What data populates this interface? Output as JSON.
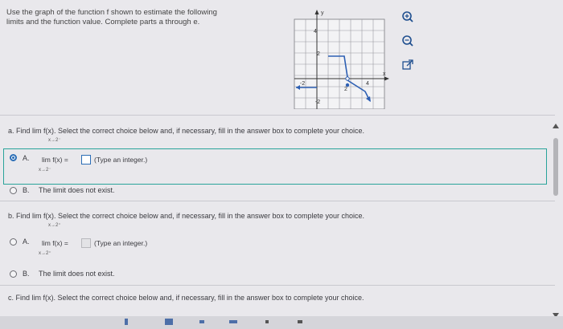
{
  "intro": {
    "line1": "Use the graph of the function f shown to estimate the following",
    "line2": "limits and the function value. Complete parts a through e."
  },
  "graph": {
    "y_axis_label": "y",
    "x_axis_label": "x",
    "tick_y_top": "4",
    "tick_y_mid": "2",
    "tick_y_bottom": "-2",
    "tick_x_left": "-2",
    "tick_x_right": "2",
    "tick_x_mid": "4"
  },
  "tools": [
    "zoom-in-icon",
    "zoom-out-icon",
    "open-external-icon"
  ],
  "part_a": {
    "question": "a. Find  lim  f(x). Select the correct choice below and, if necessary, fill in the answer box to complete your choice.",
    "subscript": "x→2⁻",
    "option_a_letter": "A.",
    "option_a_text": "lim  f(x) =",
    "option_a_sub": "x→2⁻",
    "option_a_hint": "(Type an integer.)",
    "option_a_value": "",
    "option_b_letter": "B.",
    "option_b_text": "The limit does not exist."
  },
  "part_b": {
    "question": "b. Find  lim  f(x). Select the correct choice below and, if necessary, fill in the answer box to complete your choice.",
    "subscript": "x→2⁺",
    "option_a_letter": "A.",
    "option_a_text": "lim  f(x) =",
    "option_a_sub": "x→2⁺",
    "option_a_hint": "(Type an integer.)",
    "option_a_value": "",
    "option_b_letter": "B.",
    "option_b_text": "The limit does not exist."
  },
  "part_c": {
    "question": "c. Find lim  f(x). Select the correct choice below and, if necessary, fill in the answer box to complete your choice."
  },
  "colors": {
    "selected_border": "#29a39a",
    "radio_selected": "#2b6db6",
    "graph_line": "#2d5fb3"
  }
}
